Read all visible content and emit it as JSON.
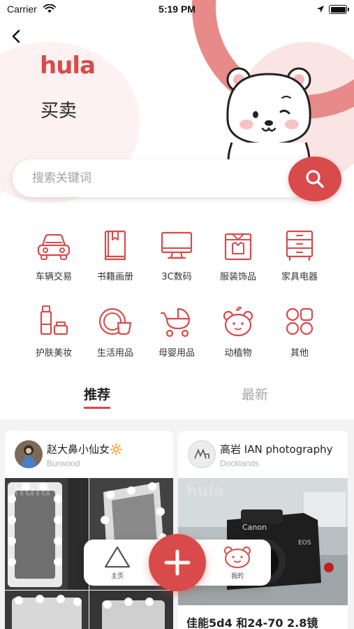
{
  "status_bar": {
    "carrier": "Carrier",
    "time": "5:19 PM"
  },
  "header": {
    "logo": "hula",
    "title": "买卖"
  },
  "search": {
    "placeholder": "搜索关键词"
  },
  "categories": [
    {
      "label": "车辆交易",
      "icon": "car-icon"
    },
    {
      "label": "书籍画册",
      "icon": "book-icon"
    },
    {
      "label": "3C数码",
      "icon": "monitor-icon"
    },
    {
      "label": "服装饰品",
      "icon": "clothing-box-icon"
    },
    {
      "label": "家具电器",
      "icon": "cabinet-icon"
    },
    {
      "label": "护肤美妆",
      "icon": "cosmetics-icon"
    },
    {
      "label": "生活用品",
      "icon": "dishes-icon"
    },
    {
      "label": "母婴用品",
      "icon": "stroller-icon"
    },
    {
      "label": "动植物",
      "icon": "bear-face-icon"
    },
    {
      "label": "其他",
      "icon": "grid-icon"
    }
  ],
  "tabs": [
    {
      "label": "推荐",
      "active": true
    },
    {
      "label": "最新",
      "active": false
    }
  ],
  "feed": [
    {
      "user": "赵大鼻小仙女🔆",
      "location": "Burwood",
      "watermark": "hula",
      "title": ""
    },
    {
      "user": "高岩 IAN photography",
      "location": "Docklands",
      "watermark": "hula",
      "title": "佳能5d4 和24-70 2.8镜"
    }
  ],
  "bottom_nav": {
    "home_label": "主页",
    "mine_label": "我的"
  },
  "colors": {
    "accent": "#d94a4a",
    "ring": "#e8898a",
    "pink_bg": "#fbe4e4"
  }
}
